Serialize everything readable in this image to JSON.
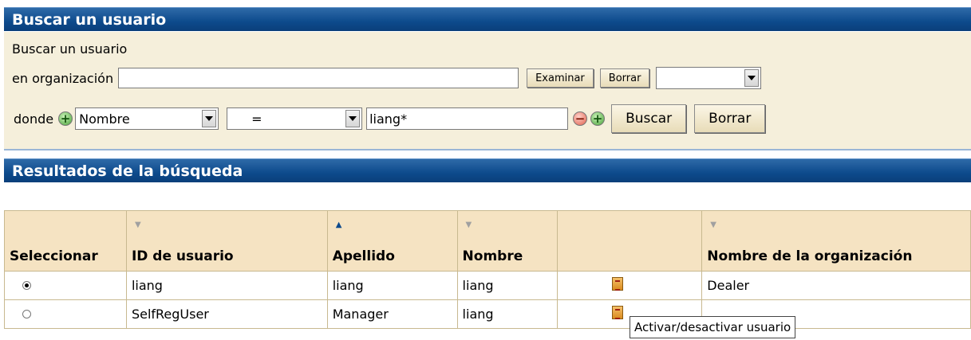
{
  "search_panel": {
    "title": "Buscar un usuario",
    "subtitle": "Buscar un usuario",
    "org_label": "en organización",
    "org_value": "",
    "browse_label": "Examinar",
    "clear_small_label": "Borrar",
    "org_scope_value": "",
    "where_label": "donde",
    "field_value": "Nombre",
    "operator_value": "=",
    "query_value": "liang*",
    "search_label": "Buscar",
    "clear_label": "Borrar"
  },
  "results_panel": {
    "title": "Resultados de la búsqueda",
    "columns": [
      "Seleccionar",
      "ID de usuario",
      "Apellido",
      "Nombre",
      "",
      "Nombre de la organización"
    ],
    "rows": [
      {
        "selected": true,
        "user_id": "liang",
        "last_name": "liang",
        "first_name": "liang",
        "icon": "toggle-user-icon",
        "org": "Dealer"
      },
      {
        "selected": false,
        "user_id": "SelfRegUser",
        "last_name": "Manager",
        "first_name": "liang",
        "icon": "toggle-user-icon",
        "org": ""
      }
    ],
    "tooltip": "Activar/desactivar usuario"
  },
  "icons": {
    "add": "plus-circle-icon",
    "remove": "minus-circle-icon",
    "dropdown": "chevron-down-icon",
    "sort_desc": "sort-desc-icon",
    "sort_asc": "sort-asc-icon"
  },
  "colors": {
    "header_bg": "#0d4a8c",
    "panel_bg": "#f5efdb",
    "table_header_bg": "#f5e3c2"
  }
}
